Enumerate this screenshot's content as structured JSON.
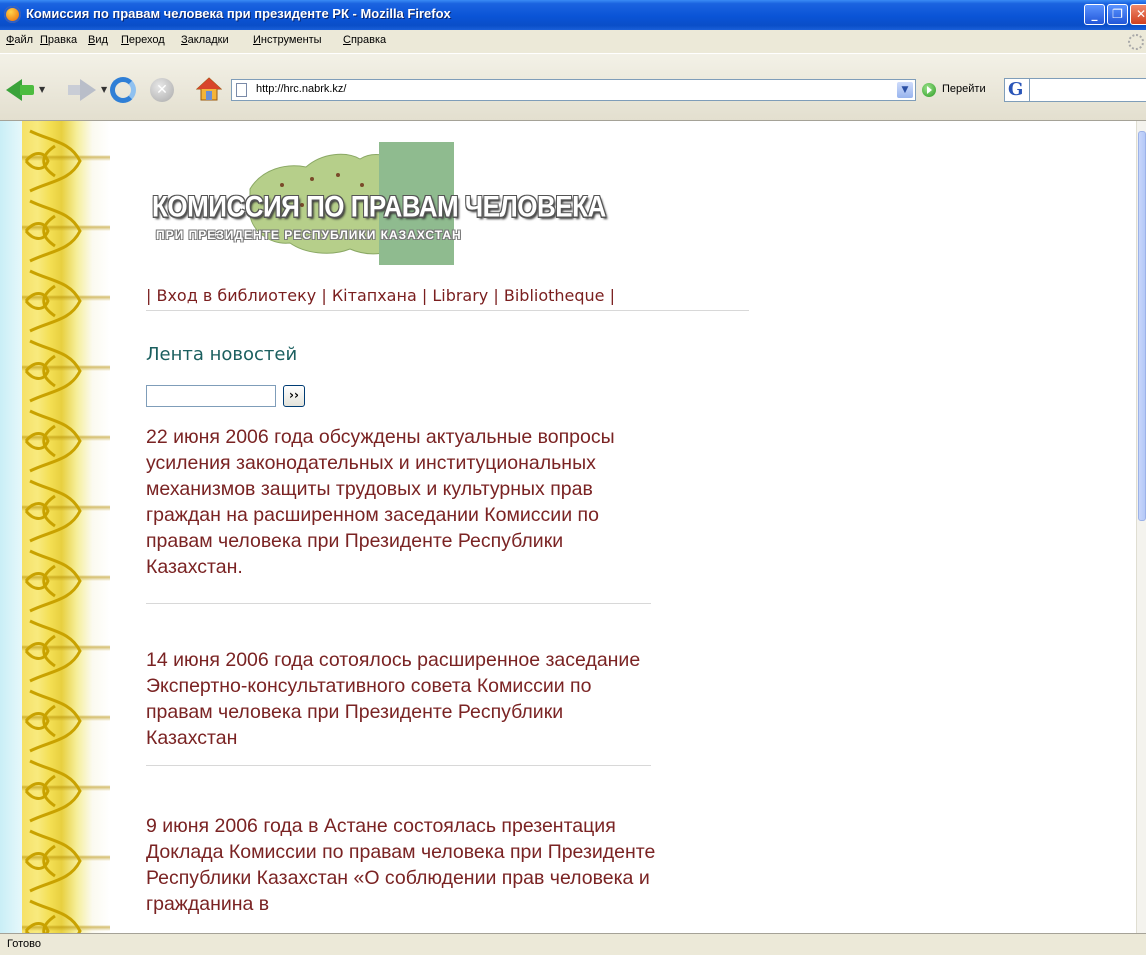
{
  "window": {
    "title": "Комиссия по правам человека при президенте РК - Mozilla Firefox"
  },
  "menu": [
    "Файл",
    "Правка",
    "Вид",
    "Переход",
    "Закладки",
    "Инструменты",
    "Справка"
  ],
  "toolbar": {
    "url": "http://hrc.nabrk.kz/",
    "go_label": "Перейти",
    "search_engine_letter": "G"
  },
  "page": {
    "logo": {
      "line1": "КОМИССИЯ ПО ПРАВАМ ЧЕЛОВЕКА",
      "line2": "ПРИ ПРЕЗИДЕНТЕ РЕСПУБЛИКИ КАЗАХСТАН"
    },
    "library_links": [
      "Вход в библиотеку",
      "Кітапхана",
      "Library",
      "Bibliotheque"
    ],
    "news_heading": "Лента новостей",
    "search_button": "››",
    "news": [
      "22 июня 2006 года обсуждены актуальные вопросы усиления законодательных и институциональных механизмов защиты трудовых и культурных прав граждан на расширенном заседании Комиссии по правам человека при Президенте Республики Казахстан.",
      "14 июня 2006 года сотоялось расширенное заседание Экспертно-консультативного совета Комиссии по правам человека при Президенте Республики Казахстан",
      "9 июня 2006 года в Астане состоялась презентация Доклада Комиссии по правам человека при Президенте Республики Казахстан «О соблюдении прав человека и гражданина в"
    ]
  },
  "status": {
    "text": "Готово"
  },
  "colors": {
    "titlebar": "#0a54d6",
    "news_text": "#7a2323",
    "heading": "#1b5f5f",
    "ornament": "#f2d84a"
  }
}
